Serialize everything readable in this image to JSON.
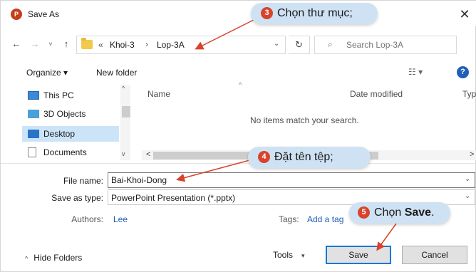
{
  "titlebar": {
    "app_icon_letter": "P",
    "title": "Save As",
    "close_glyph": "✕"
  },
  "nav": {
    "back_glyph": "←",
    "forward_glyph": "→",
    "recent_glyph": "˅",
    "up_glyph": "↑",
    "address_chevron": "«",
    "address_segments": [
      "Khoi-3",
      "Lop-3A"
    ],
    "address_separator": "›",
    "address_dropdown_glyph": "⌄",
    "refresh_glyph": "↻",
    "search_icon_glyph": "⌕",
    "search_placeholder": "Search Lop-3A"
  },
  "toolbar": {
    "organize_label": "Organize ▾",
    "new_folder_label": "New folder",
    "view_label": "☷ ▾",
    "help_glyph": "?"
  },
  "navpane": {
    "items": [
      {
        "label": "This PC",
        "icon": "computer-icon"
      },
      {
        "label": "3D Objects",
        "icon": "cube-icon"
      },
      {
        "label": "Desktop",
        "icon": "desktop-icon",
        "selected": true
      },
      {
        "label": "Documents",
        "icon": "document-icon"
      }
    ],
    "scroll_up_glyph": "^",
    "scroll_down_glyph": "v"
  },
  "filelist": {
    "columns": [
      "Name",
      "Date modified",
      "Type"
    ],
    "sort_glyph": "^",
    "empty_message": "No items match your search.",
    "scroll_left_glyph": "<",
    "scroll_right_glyph": ">"
  },
  "form": {
    "file_name_label": "File name:",
    "file_name_value": "Bai-Khoi-Dong",
    "save_type_label": "Save as type:",
    "save_type_value": "PowerPoint Presentation (*.pptx)",
    "dropdown_glyph": "⌄",
    "authors_label": "Authors:",
    "authors_value": "Lee",
    "tags_label": "Tags:",
    "tags_value": "Add a tag"
  },
  "footer": {
    "hide_folders_chevron": "^",
    "hide_folders_label": "Hide Folders",
    "tools_label": "Tools",
    "tools_chevron": "▾",
    "save_label": "Save",
    "cancel_label": "Cancel"
  },
  "callouts": {
    "step3": {
      "number": "3",
      "text": "Chọn thư mục;"
    },
    "step4": {
      "number": "4",
      "text": "Đặt tên tệp;"
    },
    "step5": {
      "number": "5",
      "text_prefix": "Chọn ",
      "text_bold": "Save",
      "text_suffix": "."
    }
  },
  "colors": {
    "accent": "#0078d7",
    "callout_bg": "#cfe2f3",
    "callout_number_bg": "#d8432a",
    "arrow": "#d8432a",
    "selection": "#cce4f7",
    "link": "#1f5fb8"
  }
}
